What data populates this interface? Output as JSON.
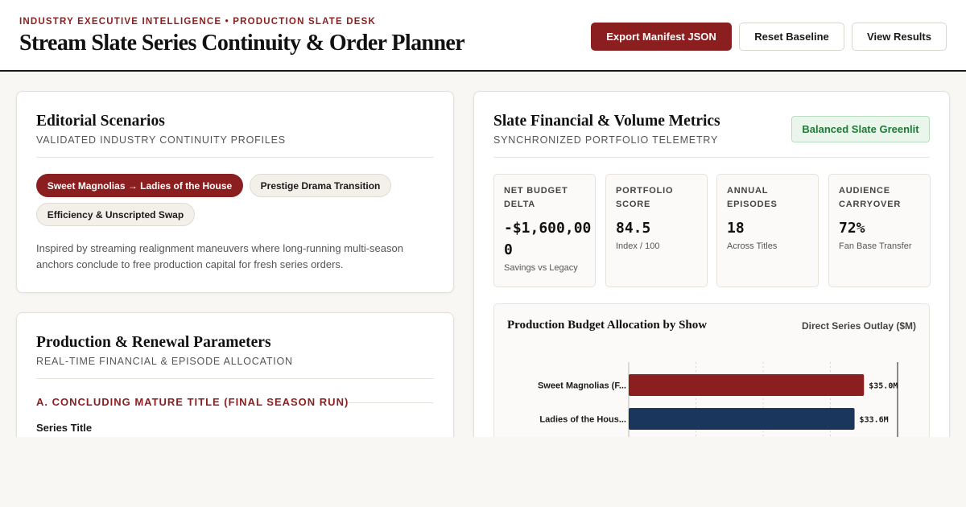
{
  "header": {
    "eyebrow": "INDUSTRY EXECUTIVE INTELLIGENCE • PRODUCTION SLATE DESK",
    "title": "Stream Slate Series Continuity & Order Planner",
    "buttons": {
      "export": "Export Manifest JSON",
      "reset": "Reset Baseline",
      "results": "View Results"
    }
  },
  "scenarios": {
    "title": "Editorial Scenarios",
    "subtitle": "VALIDATED INDUSTRY CONTINUITY PROFILES",
    "chips": [
      "Sweet Magnolias → Ladies of the House",
      "Prestige Drama Transition",
      "Efficiency & Unscripted Swap"
    ],
    "description": "Inspired by streaming realignment maneuvers where long-running multi-season anchors conclude to free production capital for fresh series orders."
  },
  "params": {
    "title": "Production & Renewal Parameters",
    "subtitle": "REAL-TIME FINANCIAL & EPISODE ALLOCATION",
    "section_a": "A. CONCLUDING MATURE TITLE (FINAL SEASON RUN)",
    "field_label": "Series Title"
  },
  "metrics": {
    "title": "Slate Financial & Volume Metrics",
    "subtitle": "SYNCHRONIZED PORTFOLIO TELEMETRY",
    "badge": "Balanced Slate Greenlit",
    "cards": [
      {
        "label": "NET BUDGET DELTA",
        "value": "-$1,600,000",
        "caption": "Savings vs Legacy"
      },
      {
        "label": "PORTFOLIO SCORE",
        "value": "84.5",
        "caption": "Index / 100"
      },
      {
        "label": "ANNUAL EPISODES",
        "value": "18",
        "caption": "Across Titles"
      },
      {
        "label": "AUDIENCE CARRYOVER",
        "value": "72%",
        "caption": "Fan Base Transfer"
      }
    ]
  },
  "chart_data": {
    "type": "bar",
    "orientation": "horizontal",
    "title": "Production Budget Allocation by Show",
    "unit_label": "Direct Series Outlay ($M)",
    "categories": [
      "Sweet Magnolias (F...",
      "Ladies of the Hous..."
    ],
    "values": [
      35.0,
      33.6
    ],
    "value_labels": [
      "$35.0M",
      "$33.6M"
    ],
    "colors": [
      "#8b1e1e",
      "#1b365d"
    ],
    "xlim": [
      0,
      40
    ],
    "grid": true
  }
}
